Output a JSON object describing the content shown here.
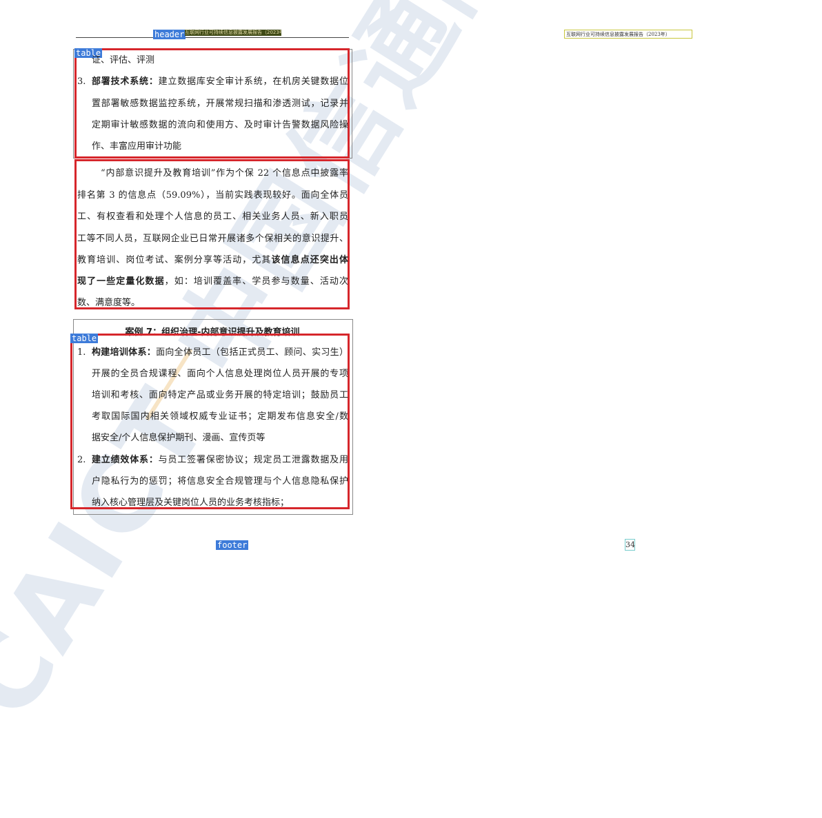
{
  "header": {
    "tag": "header",
    "left_text": "互联网行业可持续信息披露发展报告（2023年）",
    "right_text": "互联网行业可持续信息披露发展报告（2023年）"
  },
  "watermark": "CAICT 中国信通院",
  "table1": {
    "tag": "table",
    "lines": [
      "证、评估、评测",
      "置部署敏感数据监控系统，开展常规扫描和渗透测试，记录并",
      "定期审计敏感数据的流向和使用方、及时审计告警数据风险操",
      "作、丰富应用审计功能"
    ],
    "item3_num": "3.",
    "item3_bold": "部署技术系统：",
    "item3_rest": "建立数据库安全审计系统，在机房关键数据位"
  },
  "paragraph": {
    "lines": [
      "“内部意识提升及教育培训”作为个保 22 个信息点中披露率",
      "排名第 3 的信息点（59.09%），当前实践表现较好。面向全体员",
      "工、有权查看和处理个人信息的员工、相关业务人员、新入职员",
      "工等不同人员，互联网企业已日常开展诸多个保相关的意识提升、"
    ],
    "line5_pre": "教育培训、岗位考试、案例分享等活动，尤其",
    "line5_bold": "该信息点还突出体",
    "line6_bold": "现了一些定量化数据",
    "line6_rest": "，如：培训覆盖率、学员参与数量、活动次",
    "line7": "数、满意度等。"
  },
  "case": {
    "caption": "案例 7：组织治理-内部意识提升及教育培训",
    "tag": "table",
    "item1_num": "1.",
    "item1_bold": "构建培训体系：",
    "item1_rest": "面向全体员工（包括正式员工、顾问、实习生）",
    "item1_lines": [
      "开展的全员合规课程、面向个人信息处理岗位人员开展的专项",
      "培训和考核、面向特定产品或业务开展的特定培训；鼓励员工",
      "考取国际国内相关领域权威专业证书；定期发布信息安全/数",
      "据安全/个人信息保护期刊、漫画、宣传页等"
    ],
    "item2_num": "2.",
    "item2_bold": "建立绩效体系：",
    "item2_rest": "与员工签署保密协议；规定员工泄露数据及用",
    "item2_lines": [
      "户隐私行为的惩罚；将信息安全合规管理与个人信息隐私保护",
      "纳入核心管理层及关键岗位人员的业务考核指标；"
    ]
  },
  "footer": {
    "tag": "footer",
    "page_number": "34"
  }
}
